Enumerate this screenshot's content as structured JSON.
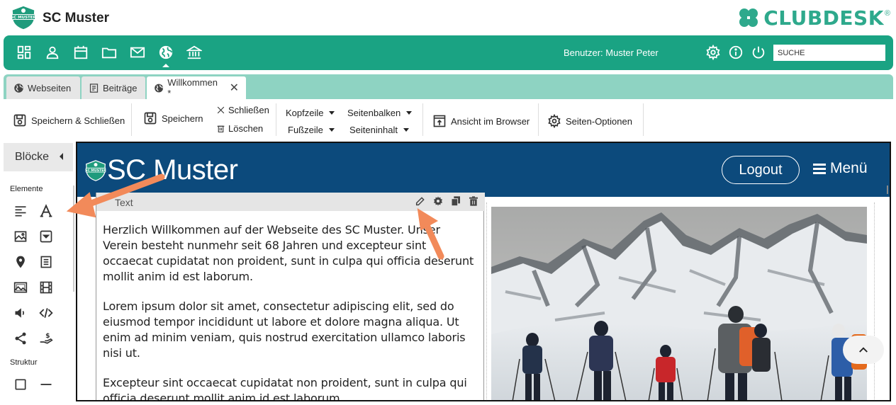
{
  "app": {
    "club_name": "SC Muster",
    "brand": "CLUBDESK",
    "brand_mark": "®",
    "brand_color": "#2ea98c",
    "accent_color": "#1aa383"
  },
  "nav": {
    "icons": [
      "dashboard-icon",
      "person-icon",
      "calendar-icon",
      "folder-icon",
      "mail-icon",
      "globe-icon",
      "bank-icon"
    ],
    "active": "globe-icon",
    "user_label": "Benutzer: Muster Peter",
    "search_placeholder": "SUCHE"
  },
  "tabs": [
    {
      "label": "Webseiten",
      "icon": "globe-icon"
    },
    {
      "label": "Beiträge",
      "icon": "document-icon"
    },
    {
      "label": "Willkommen *",
      "icon": "globe-icon",
      "active": true
    }
  ],
  "toolbar": {
    "save_close": "Speichern & Schließen",
    "save": "Speichern",
    "close": "Schließen",
    "delete": "Löschen",
    "header": "Kopfzeile",
    "footer": "Fußzeile",
    "sidebar": "Seitenbalken",
    "page_content": "Seiteninhalt",
    "view_browser": "Ansicht im Browser",
    "page_options": "Seiten-Optionen"
  },
  "left_panel": {
    "title": "Blöcke",
    "elements_label": "Elemente",
    "structure_label": "Struktur",
    "element_icons": [
      "text-align-icon",
      "font-icon",
      "image-icon",
      "dropdown-icon",
      "map-pin-icon",
      "form-icon",
      "gallery-icon",
      "film-icon",
      "speaker-icon",
      "code-icon",
      "share-icon",
      "donation-icon"
    ],
    "structure_icons": [
      "box-icon",
      "divider-icon"
    ]
  },
  "preview": {
    "site_title": "SC Muster",
    "logout": "Logout",
    "menu": "Menü",
    "text_block_title": "Text",
    "paragraphs": [
      "Herzlich Willkommen auf der Webseite des SC Muster. Unser Verein besteht nunmehr seit 68 Jahren und excepteur sint occaecat cupidatat non proident, sunt in culpa qui officia deserunt mollit anim id est laborum.",
      "Lorem ipsum dolor sit amet, consectetur adipiscing elit, sed do eiusmod tempor incididunt ut labore et dolore magna aliqua. Ut enim ad minim veniam, quis nostrud exercitation ullamco laboris nisi ut.",
      "Excepteur sint occaecat cupidatat non proident, sunt in culpa qui officia deserunt mollit anim id est laborum."
    ],
    "header_color": "#0c4a7c"
  },
  "annotation_color": "#f28a5a"
}
